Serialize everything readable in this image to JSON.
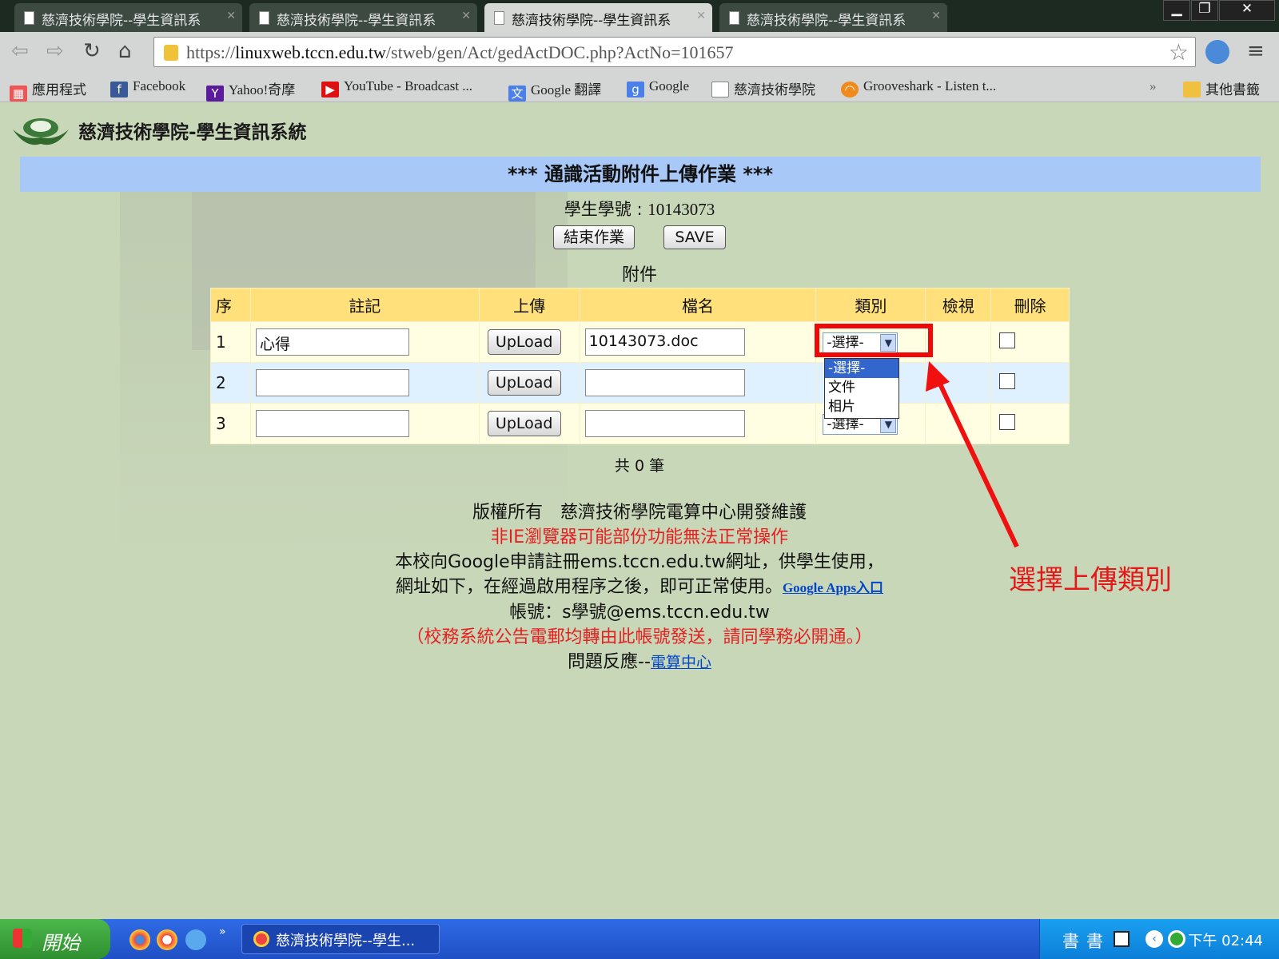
{
  "browser": {
    "tabs": [
      {
        "title": "慈濟技術學院--學生資訊系"
      },
      {
        "title": "慈濟技術學院--學生資訊系"
      },
      {
        "title": "慈濟技術學院--學生資訊系"
      },
      {
        "title": "慈濟技術學院--學生資訊系"
      }
    ],
    "url_prefix": "https://",
    "url_host": "linuxweb.tccn.edu.tw",
    "url_path": "/stweb/gen/Act/gedActDOC.php?ActNo=101657",
    "bookmarks": [
      {
        "label": "應用程式",
        "icon": "apps-icon"
      },
      {
        "label": "Facebook",
        "icon": "facebook-icon"
      },
      {
        "label": "Yahoo!奇摩",
        "icon": "yahoo-icon"
      },
      {
        "label": "YouTube - Broadcast ...",
        "icon": "youtube-icon"
      },
      {
        "label": "Google 翻譯",
        "icon": "google-translate-icon"
      },
      {
        "label": "Google",
        "icon": "google-icon"
      },
      {
        "label": "慈濟技術學院",
        "icon": "page-icon"
      },
      {
        "label": "Grooveshark - Listen t...",
        "icon": "grooveshark-icon"
      }
    ],
    "other_bookmarks": "其他書籤",
    "overflow": "»"
  },
  "page": {
    "site_title": "慈濟技術學院-學生資訊系統",
    "banner": "*** 通識活動附件上傳作業 ***",
    "student_id_label": "學生學號 : ",
    "student_id": "10143073",
    "end_button": "結束作業",
    "save_button": "SAVE",
    "attach_title": "附件",
    "columns": [
      "序",
      "註記",
      "上傳",
      "檔名",
      "類別",
      "檢視",
      "刪除"
    ],
    "rows": [
      {
        "seq": "1",
        "note": "心得",
        "upload": "UpLoad",
        "filename": "10143073.doc",
        "category": "-選擇-"
      },
      {
        "seq": "2",
        "note": "",
        "upload": "UpLoad",
        "filename": "",
        "category": "-選擇-"
      },
      {
        "seq": "3",
        "note": "",
        "upload": "UpLoad",
        "filename": "",
        "category": "-選擇-"
      }
    ],
    "category_options": [
      "-選擇-",
      "文件",
      "相片"
    ],
    "count_text": "共 0 筆",
    "footer": {
      "copyright": "版權所有　慈濟技術學院電算中心開發維護",
      "browser_warning": "非IE瀏覽器可能部份功能無法正常操作",
      "google_line1": "本校向Google申請註冊ems.tccn.edu.tw網址，供學生使用，",
      "google_line2": "網址如下，在經過啟用程序之後，即可正常使用。",
      "google_link": "Google Apps入口",
      "account": "帳號：s學號@ems.tccn.edu.tw",
      "notice": "（校務系統公告電郵均轉由此帳號發送，請同學務必開通。）",
      "feedback_label": "問題反應--",
      "feedback_link": "電算中心"
    }
  },
  "annotation": {
    "note_text": "選擇上傳類別",
    "color": "#e41818"
  },
  "taskbar": {
    "start_label": "開始",
    "task_item": "慈濟技術學院--學生...",
    "clock": "下午 02:44",
    "ime1": "書",
    "ime2": "書"
  }
}
